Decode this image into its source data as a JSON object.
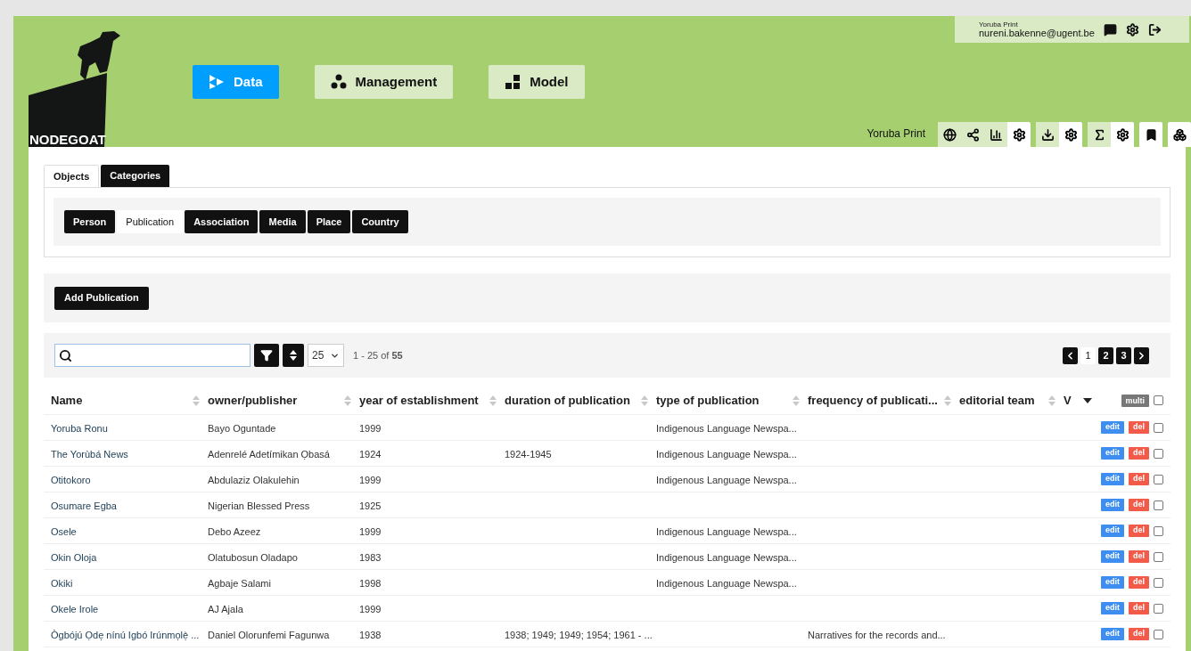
{
  "logo": {
    "text": "NODEGOAT"
  },
  "nav": [
    {
      "label": "Data",
      "kind": "data",
      "selected": true
    },
    {
      "label": "Management",
      "kind": "management",
      "selected": false
    },
    {
      "label": "Model",
      "kind": "model",
      "selected": false
    }
  ],
  "user": {
    "project": "Yoruba Print",
    "email": "nureni.bakenne@ugent.be"
  },
  "toolbar": {
    "project": "Yoruba Print"
  },
  "tabs": [
    {
      "label": "Objects",
      "selected": true
    },
    {
      "label": "Categories",
      "selected": false
    }
  ],
  "types": [
    {
      "label": "Person",
      "selected": false
    },
    {
      "label": "Publication",
      "selected": true
    },
    {
      "label": "Association",
      "selected": false
    },
    {
      "label": "Media",
      "selected": false
    },
    {
      "label": "Place",
      "selected": false
    },
    {
      "label": "Country",
      "selected": false
    }
  ],
  "add_button": "Add Publication",
  "page_size": "25",
  "range": "1 - 25 of **55**",
  "pages": [
    {
      "label": "1",
      "selected": true
    },
    {
      "label": "2",
      "selected": false
    },
    {
      "label": "3",
      "selected": false
    }
  ],
  "table": {
    "columns": [
      {
        "label": "Name"
      },
      {
        "label": "owner/publisher"
      },
      {
        "label": "year of establishment"
      },
      {
        "label": "duration of publication"
      },
      {
        "label": "type of publication"
      },
      {
        "label": "frequency of publicati..."
      },
      {
        "label": "editorial team"
      },
      {
        "label": "V"
      }
    ],
    "multi": "multi",
    "multi_checked": false,
    "rows": [
      {
        "cells": [
          "Yoruba Ronu",
          "Bayo Oguntade",
          "1999",
          "",
          "Indigenous Language Newspa...",
          "",
          "",
          ""
        ],
        "edit": "edit",
        "del": "del",
        "checked": false
      },
      {
        "cells": [
          "The Yorùbá News",
          "Adenrelé Adetímikan Ọbasá",
          "1924",
          "1924-1945",
          "Indigenous Language Newspa...",
          "",
          "",
          ""
        ],
        "edit": "edit",
        "del": "del",
        "checked": false
      },
      {
        "cells": [
          "Otitokoro",
          "Abdulaziz Olakulehin",
          "1999",
          "",
          "Indigenous Language Newspa...",
          "",
          "",
          ""
        ],
        "edit": "edit",
        "del": "del",
        "checked": false
      },
      {
        "cells": [
          "Osumare Egba",
          "Nigerian Blessed Press",
          "1925",
          "",
          "",
          "",
          "",
          ""
        ],
        "edit": "edit",
        "del": "del",
        "checked": false
      },
      {
        "cells": [
          "Osele",
          "Debo Azeez",
          "1999",
          "",
          "Indigenous Language Newspa...",
          "",
          "",
          ""
        ],
        "edit": "edit",
        "del": "del",
        "checked": false
      },
      {
        "cells": [
          "Okin Oloja",
          "Olatubosun Oladapo",
          "1983",
          "",
          "Indigenous Language Newspa...",
          "",
          "",
          ""
        ],
        "edit": "edit",
        "del": "del",
        "checked": false
      },
      {
        "cells": [
          "Okiki",
          "Agbaje Salami",
          "1998",
          "",
          "Indigenous Language Newspa...",
          "",
          "",
          ""
        ],
        "edit": "edit",
        "del": "del",
        "checked": false
      },
      {
        "cells": [
          "Okele Irole",
          "AJ Ajala",
          "1999",
          "",
          "",
          "",
          "",
          ""
        ],
        "edit": "edit",
        "del": "del",
        "checked": false
      },
      {
        "cells": [
          "Ògbójú Ọdẹ nínú Igbó Irúnmọlẹ̀ ...",
          "Daniel Olorunfemi Fagunwa",
          "1938",
          "1938; 1949; 1949; 1954; 1961 - ...",
          "",
          "Narratives for the records and...",
          "",
          ""
        ],
        "edit": "edit",
        "del": "del",
        "checked": false
      }
    ]
  }
}
